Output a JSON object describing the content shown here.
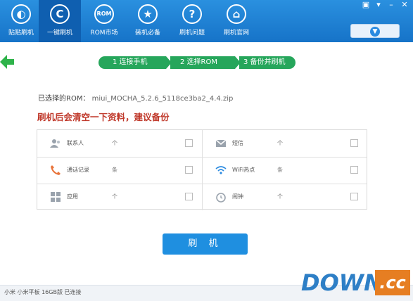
{
  "nav": [
    {
      "label": "贴贴刷机",
      "icon": "logo-icon"
    },
    {
      "label": "一键刷机",
      "icon": "c-icon"
    },
    {
      "label": "ROM市场",
      "icon": "rom-icon"
    },
    {
      "label": "装机必备",
      "icon": "star-icon"
    },
    {
      "label": "刷机问题",
      "icon": "question-icon"
    },
    {
      "label": "刷机官网",
      "icon": "home-icon"
    }
  ],
  "steps": [
    {
      "label": "1  连接手机"
    },
    {
      "label": "2  选择ROM"
    },
    {
      "label": "3  备份并刷机"
    }
  ],
  "rom": {
    "label": "已选择的ROM：",
    "filename": "miui_MOCHA_5.2.6_5118ce3ba2_4.4.zip"
  },
  "warning": "刷机后会清空一下资料，建议备份",
  "backup_items": [
    {
      "name": "联系人",
      "unit": "个",
      "icon": "contacts-icon"
    },
    {
      "name": "短信",
      "unit": "个",
      "icon": "sms-icon"
    },
    {
      "name": "通话记录",
      "unit": "条",
      "icon": "phone-icon"
    },
    {
      "name": "WiFi热点",
      "unit": "条",
      "icon": "wifi-icon"
    },
    {
      "name": "应用",
      "unit": "个",
      "icon": "apps-icon"
    },
    {
      "name": "闹钟",
      "unit": "个",
      "icon": "alarm-icon"
    }
  ],
  "flash_button": "刷 机",
  "status_text": "小米 小米平板 16GB版 已连接",
  "watermark": {
    "part1": "DOWN",
    "part2": ".cc"
  },
  "colors": {
    "topbar": "#1a7fd4",
    "step": "#26a65b",
    "warning": "#c0392b",
    "button": "#1f8fe0"
  }
}
